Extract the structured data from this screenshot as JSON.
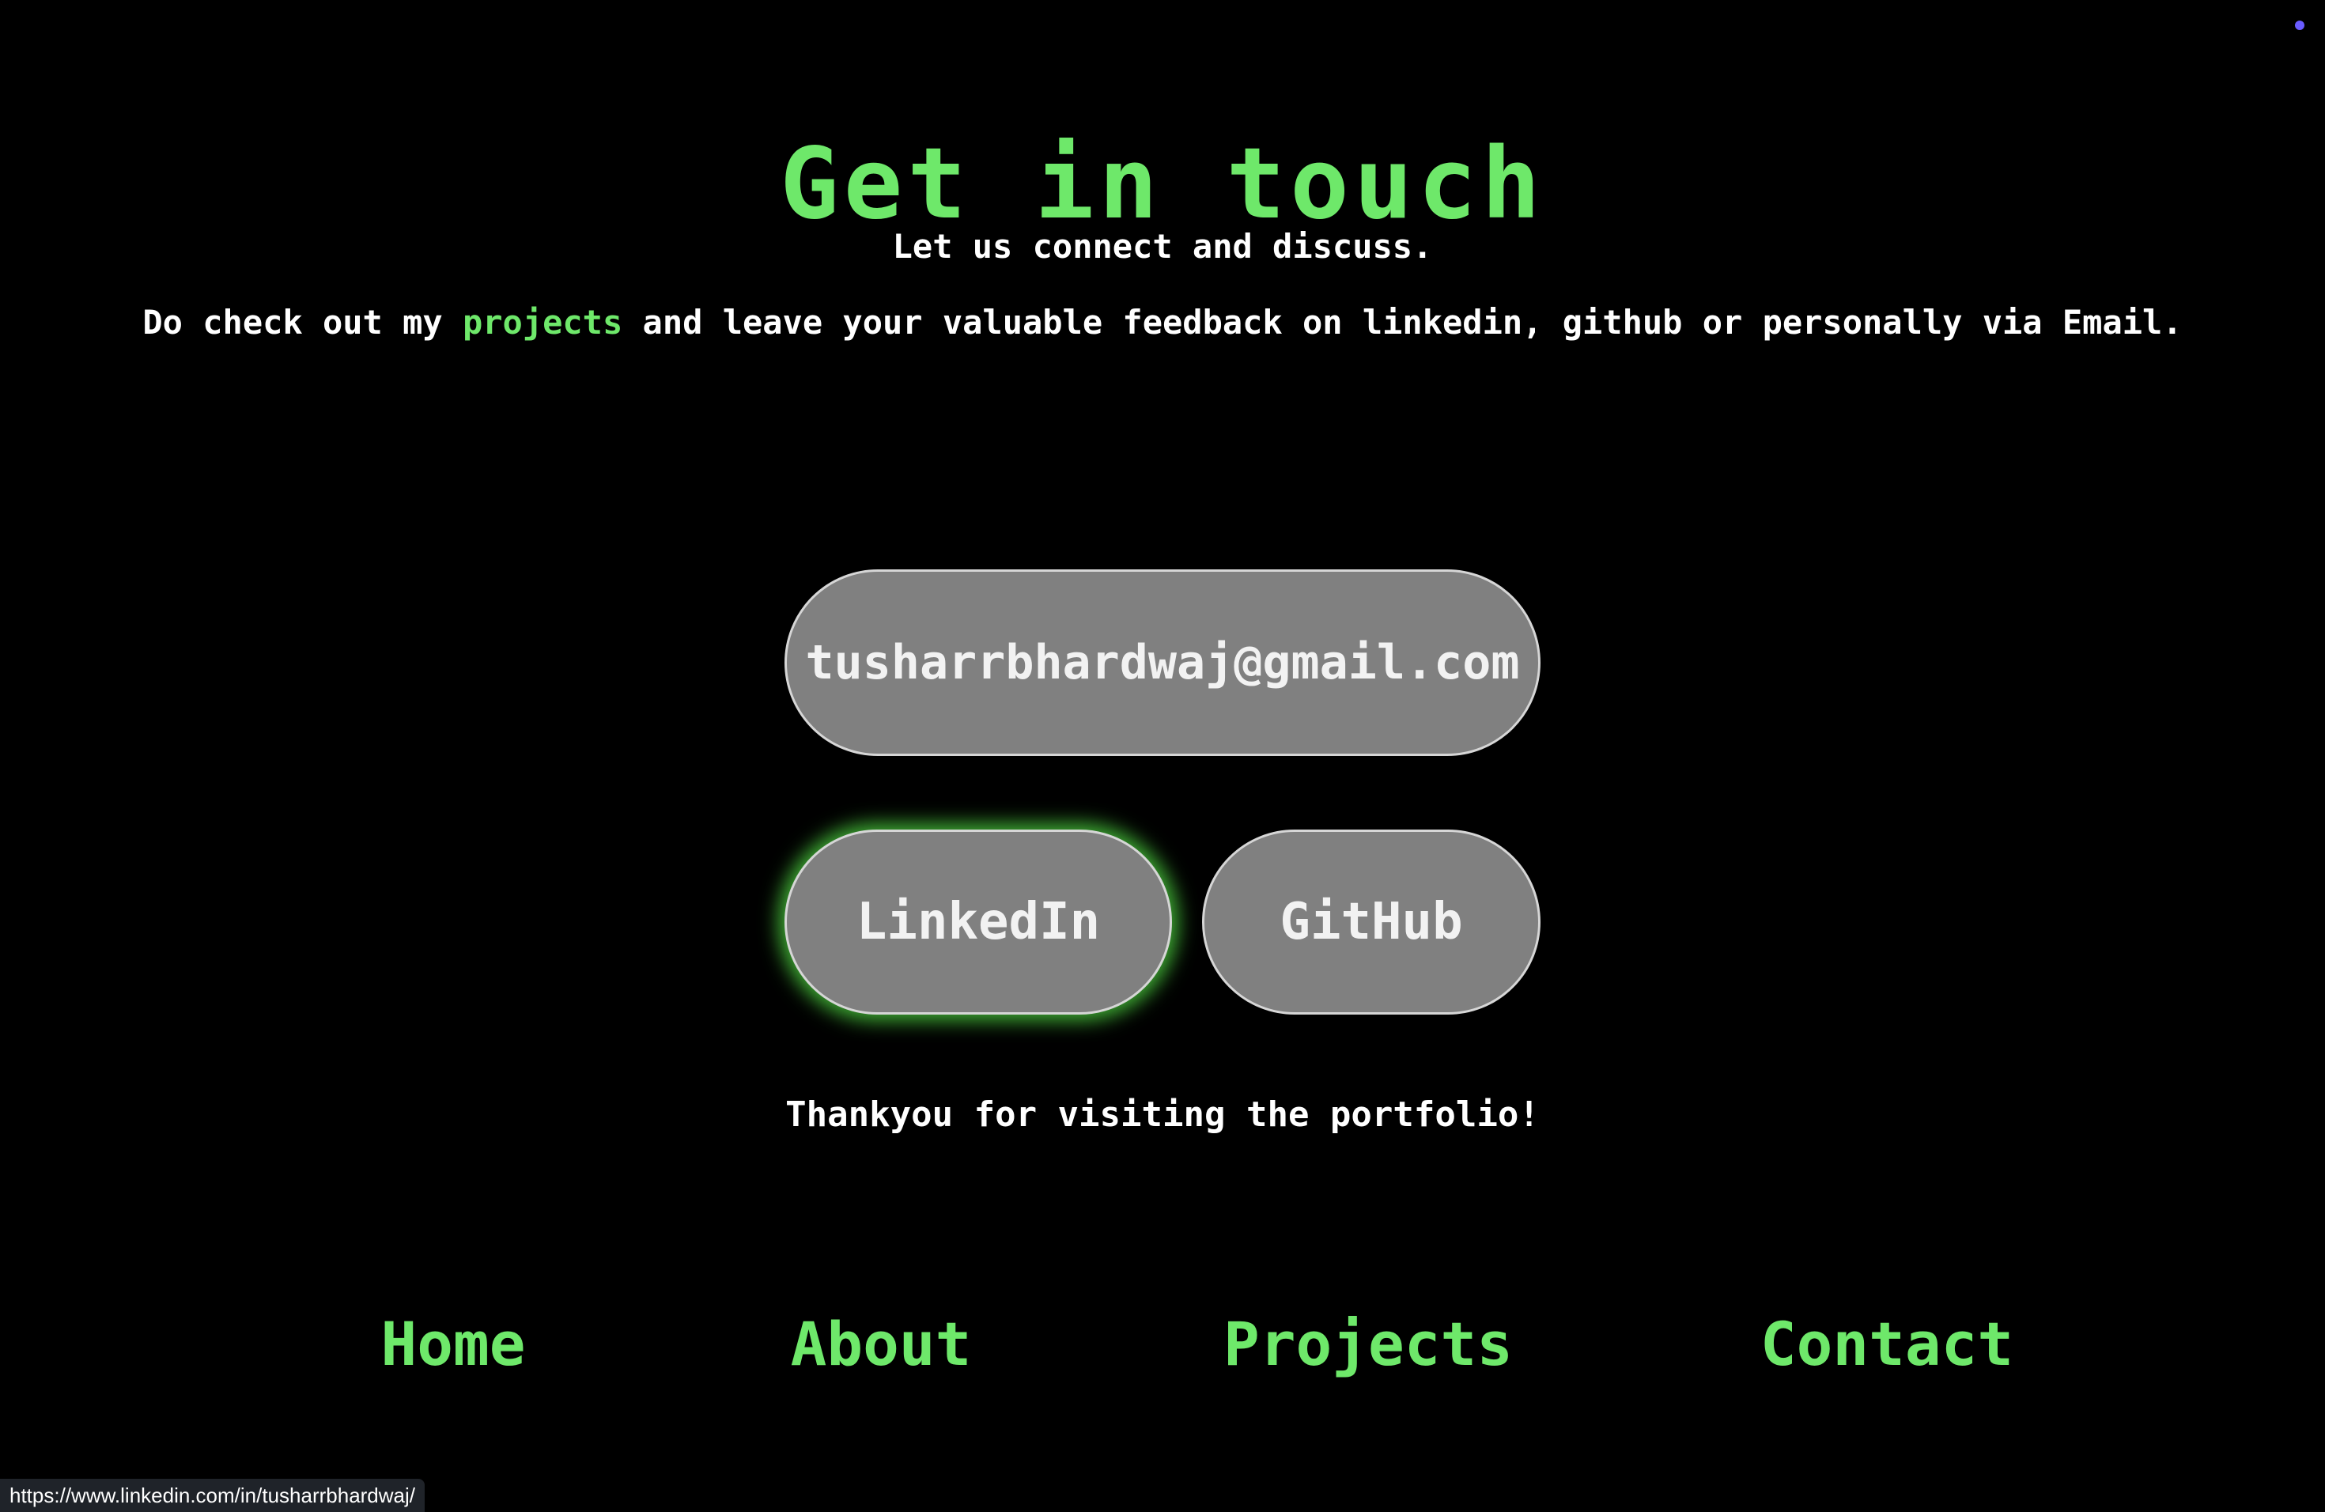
{
  "page": {
    "title": "Get in touch",
    "subtitle": "Let us connect and discuss.",
    "subtext_before": "Do check out my ",
    "subtext_link": "projects",
    "subtext_after": " and leave your valuable feedback on linkedin, github or personally via Email.",
    "thanks": "Thankyou for visiting the portfolio!"
  },
  "contact": {
    "email_label": "tusharrbhardwaj@gmail.com",
    "linkedin_label": "LinkedIn",
    "github_label": "GitHub"
  },
  "nav": {
    "items": [
      {
        "label": "Home"
      },
      {
        "label": "About"
      },
      {
        "label": "Projects"
      },
      {
        "label": "Contact"
      }
    ]
  },
  "status_bar": {
    "url": "https://www.linkedin.com/in/tusharrbhardwaj/"
  },
  "colors": {
    "accent": "#6ee86a",
    "button_bg": "#808080",
    "glow": "#54e646",
    "background": "#000000"
  }
}
